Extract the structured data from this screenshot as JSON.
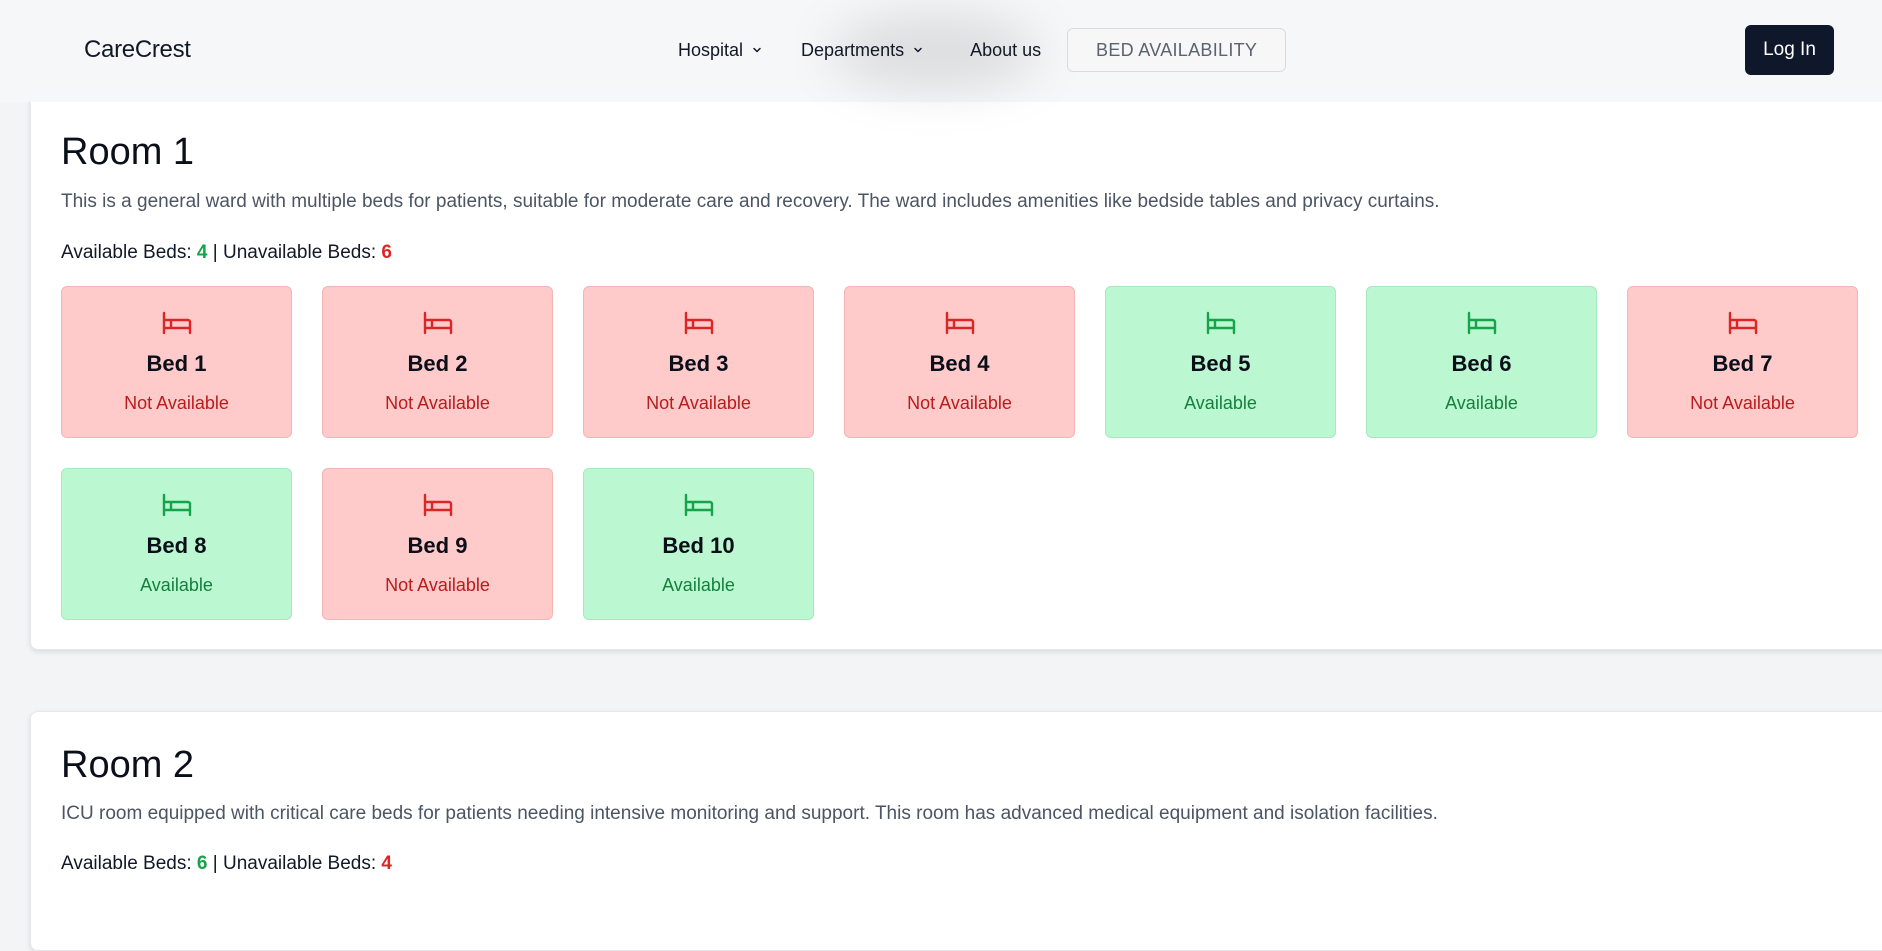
{
  "nav": {
    "brand": "CareCrest",
    "hospital_label": "Hospital",
    "departments_label": "Departments",
    "about_label": "About us",
    "bed_availability_label": "BED AVAILABILITY",
    "login_label": "Log In"
  },
  "colors": {
    "available_bg": "#bbf7d0",
    "available_text": "#15803d",
    "available_icon": "#16a34a",
    "unavailable_bg": "#fecaca",
    "unavailable_text": "#b91c1c",
    "unavailable_icon": "#dc2626",
    "login_bg": "#0f172a"
  },
  "rooms": [
    {
      "title": "Room 1",
      "description": "This is a general ward with multiple beds for patients, suitable for moderate care and recovery. The ward includes amenities like bedside tables and privacy curtains.",
      "available_label": "Available Beds: ",
      "available_count": "4",
      "separator": " | ",
      "unavailable_label": "Unavailable Beds: ",
      "unavailable_count": "6",
      "beds": [
        {
          "name": "Bed 1",
          "status": "Not Available",
          "available": false,
          "icon": "bed-icon"
        },
        {
          "name": "Bed 2",
          "status": "Not Available",
          "available": false,
          "icon": "bed-icon"
        },
        {
          "name": "Bed 3",
          "status": "Not Available",
          "available": false,
          "icon": "bed-icon"
        },
        {
          "name": "Bed 4",
          "status": "Not Available",
          "available": false,
          "icon": "bed-icon"
        },
        {
          "name": "Bed 5",
          "status": "Available",
          "available": true,
          "icon": "bed-icon"
        },
        {
          "name": "Bed 6",
          "status": "Available",
          "available": true,
          "icon": "bed-icon"
        },
        {
          "name": "Bed 7",
          "status": "Not Available",
          "available": false,
          "icon": "bed-icon"
        },
        {
          "name": "Bed 8",
          "status": "Available",
          "available": true,
          "icon": "bed-icon"
        },
        {
          "name": "Bed 9",
          "status": "Not Available",
          "available": false,
          "icon": "bed-icon"
        },
        {
          "name": "Bed 10",
          "status": "Available",
          "available": true,
          "icon": "bed-icon"
        }
      ]
    },
    {
      "title": "Room 2",
      "description": "ICU room equipped with critical care beds for patients needing intensive monitoring and support. This room has advanced medical equipment and isolation facilities.",
      "available_label": "Available Beds: ",
      "available_count": "6",
      "separator": " | ",
      "unavailable_label": "Unavailable Beds: ",
      "unavailable_count": "4",
      "beds": []
    }
  ]
}
